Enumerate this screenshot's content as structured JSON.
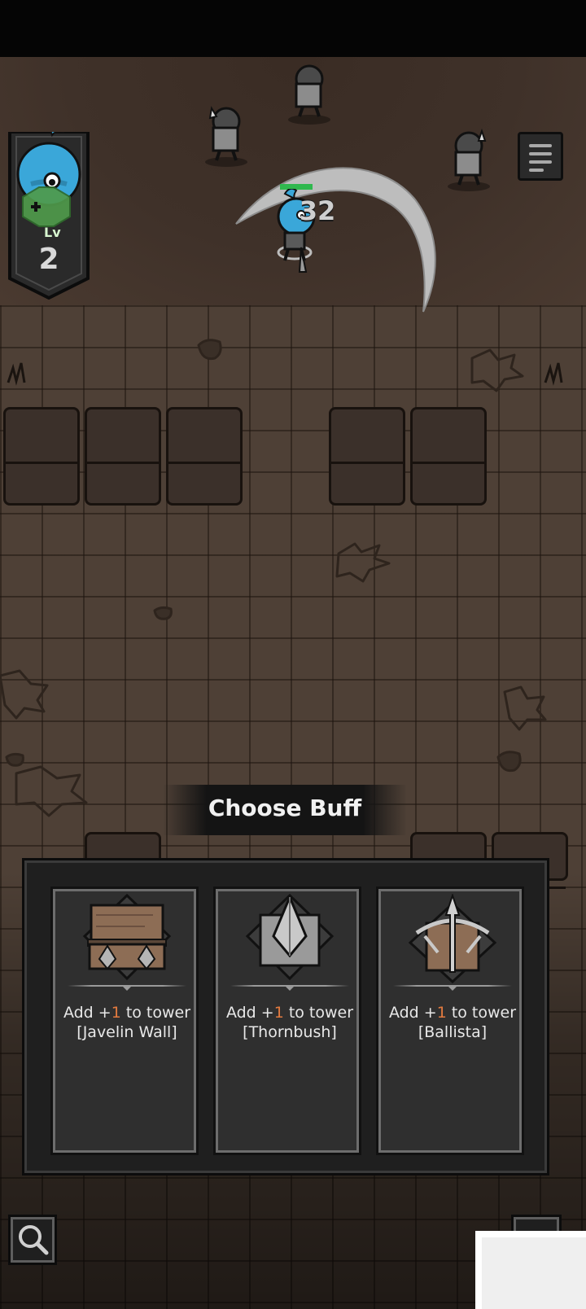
{
  "hud": {
    "level_label": "Lv",
    "level_value": "2",
    "damage_popup": "32",
    "player_hp_fraction": 1.0
  },
  "dialog": {
    "title": "Choose Buff",
    "cards": [
      {
        "prefix": "Add +",
        "amount": "1",
        "suffix": " to tower [Javelin Wall]",
        "icon": "javelin-wall-icon"
      },
      {
        "prefix": "Add +",
        "amount": "1",
        "suffix": " to tower [Thornbush]",
        "icon": "thornbush-icon"
      },
      {
        "prefix": "Add +",
        "amount": "1",
        "suffix": " to tower [Ballista]",
        "icon": "ballista-icon"
      }
    ]
  },
  "controls": {
    "menu": "menu-icon",
    "zoom": "magnifier-icon"
  },
  "colors": {
    "highlight": "#e27a3f",
    "hp_bar": "#2fb84e",
    "player": "#3aa7d9",
    "level_badge": "#4f9a4b"
  }
}
